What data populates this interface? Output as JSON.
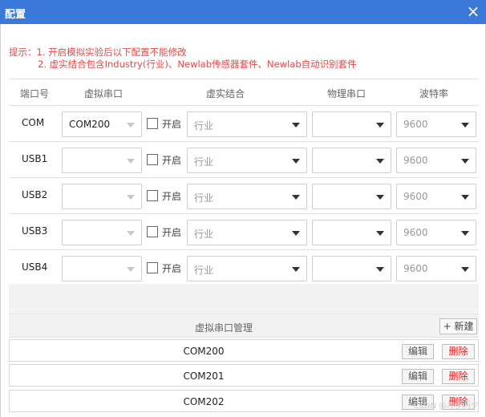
{
  "window": {
    "title": "配置",
    "close_icon": "×"
  },
  "hint": {
    "line1": "提示：1. 开启模拟实验后以下配置不能修改",
    "line2": "2. 虚实结合包含Industry(行业)、Newlab传感器套件、Newlab自动识别套件"
  },
  "table": {
    "headers": [
      "端口号",
      "虚拟串口",
      "虚实结合",
      "物理串口",
      "波特率"
    ],
    "rows": [
      {
        "port": "COM",
        "virtual": "COM200",
        "open_label": "开启",
        "mix": "行业",
        "physical": "",
        "baud": "9600"
      },
      {
        "port": "USB1",
        "virtual": "",
        "open_label": "开启",
        "mix": "行业",
        "physical": "",
        "baud": "9600"
      },
      {
        "port": "USB2",
        "virtual": "",
        "open_label": "开启",
        "mix": "行业",
        "physical": "",
        "baud": "9600"
      },
      {
        "port": "USB3",
        "virtual": "",
        "open_label": "开启",
        "mix": "行业",
        "physical": "",
        "baud": "9600"
      },
      {
        "port": "USB4",
        "virtual": "",
        "open_label": "开启",
        "mix": "行业",
        "physical": "",
        "baud": "9600"
      }
    ]
  },
  "manager": {
    "title": "虚拟串口管理",
    "new_label": "+ 新建",
    "items": [
      {
        "name": "COM200",
        "edit": "编辑",
        "delete": "删除"
      },
      {
        "name": "COM201",
        "edit": "编辑",
        "delete": "删除"
      },
      {
        "name": "COM202",
        "edit": "编辑",
        "delete": "删除"
      }
    ]
  },
  "watermark": "CSDN @才子门夕",
  "colors": {
    "titlebar": "#3a79d9",
    "hint": "#e04848",
    "delete": "#e02020"
  }
}
